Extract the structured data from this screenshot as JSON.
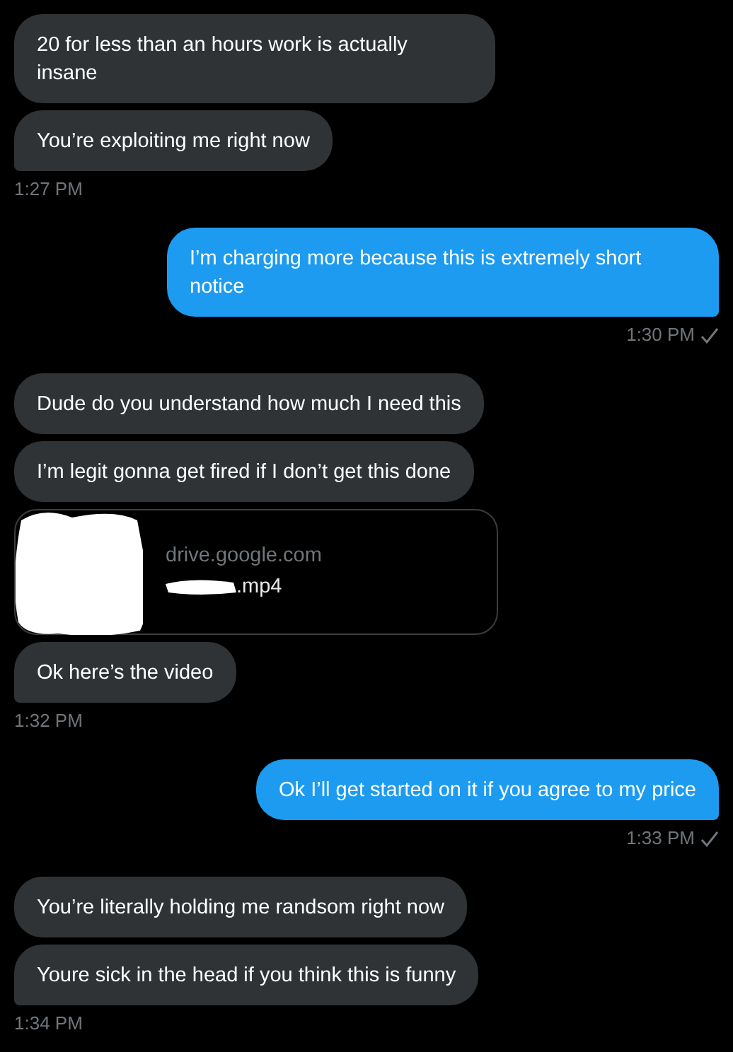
{
  "conversation": [
    {
      "kind": "received",
      "messages": [
        {
          "kind": "text",
          "text": "20 for less than an hours work is actually insane"
        },
        {
          "kind": "text",
          "text": "You’re exploiting me right now"
        }
      ],
      "time": "1:27 PM",
      "read": false
    },
    {
      "kind": "sent",
      "messages": [
        {
          "kind": "text",
          "text": "I’m charging more because this is extremely short notice"
        }
      ],
      "time": "1:30 PM",
      "read": true
    },
    {
      "kind": "received",
      "messages": [
        {
          "kind": "text",
          "text": "Dude do you understand how much I need this"
        },
        {
          "kind": "text",
          "text": "I’m legit gonna get fired if I don’t get this done"
        },
        {
          "kind": "link",
          "domain": "drive.google.com",
          "filename": ".mp4"
        },
        {
          "kind": "text",
          "text": "Ok here’s the video"
        }
      ],
      "time": "1:32 PM",
      "read": false
    },
    {
      "kind": "sent",
      "messages": [
        {
          "kind": "text",
          "text": "Ok I’ll get started on it if you agree to my price"
        }
      ],
      "time": "1:33 PM",
      "read": true
    },
    {
      "kind": "received",
      "messages": [
        {
          "kind": "text",
          "text": "You’re literally holding me randsom right now"
        },
        {
          "kind": "text",
          "text": "Youre sick in the head if you think this is funny"
        }
      ],
      "time": "1:34 PM",
      "read": false
    }
  ]
}
